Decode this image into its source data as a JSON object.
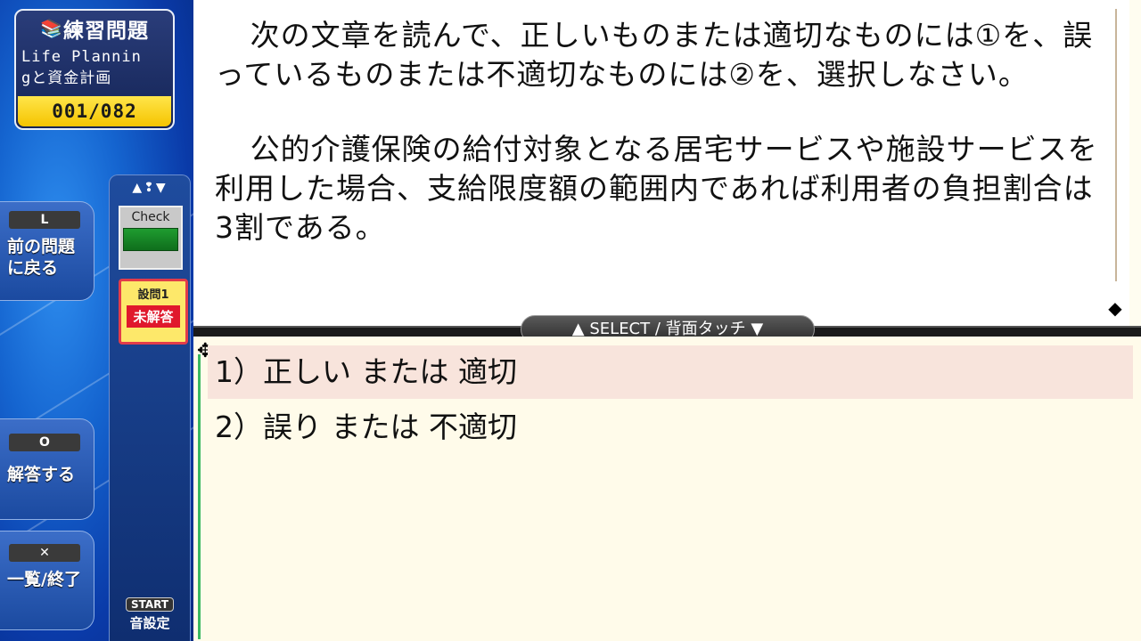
{
  "sidebar": {
    "title": "練習問題",
    "subtitle_line1": "Life Plannin",
    "subtitle_line2": "gと資金計画",
    "counter": "001/082",
    "buttons": [
      {
        "key": "L",
        "label_line1": "前の問題",
        "label_line2": "に戻る"
      },
      {
        "key": "O",
        "label_line1": "解答する",
        "label_line2": ""
      },
      {
        "key": "✕",
        "label_line1": "一覧/終了",
        "label_line2": ""
      }
    ],
    "check_label": "Check",
    "question_label": "設問1",
    "status": "未解答",
    "start_key": "START",
    "start_label": "音設定"
  },
  "question": {
    "paragraph1": "次の文章を読んで、正しいものまたは適切なものには①を、誤っているものまたは不適切なものには②を、選択しなさい。",
    "paragraph2": "公的介護保険の給付対象となる居宅サービスや施設サービスを利用した場合、支給限度額の範囲内であれば利用者の負担割合は3割である。"
  },
  "select_bar": "▲ SELECT / 背面タッチ ▼",
  "choices": [
    {
      "label": "1）正しい または 適切",
      "selected": true
    },
    {
      "label": "2）誤り または 不適切",
      "selected": false
    }
  ],
  "icons": {
    "title_icon": "book-icon",
    "nav_icon": "arrows-icon",
    "r_marker": "r-scroll-marker-icon",
    "cursor_icon": "move-cursor-icon"
  },
  "colors": {
    "accent_yellow": "#f5c400",
    "status_red": "#e0182c",
    "selected_row": "#f8e4dc"
  }
}
